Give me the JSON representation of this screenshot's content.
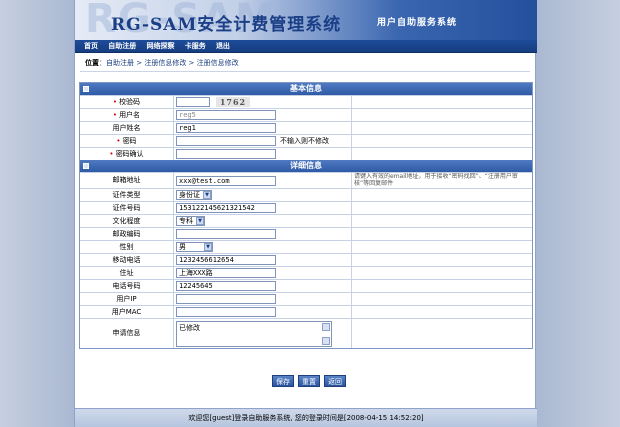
{
  "banner": {
    "ghost": "RG-SAM",
    "title": "RG-SAM安全计费管理系统",
    "subtitle": "用户自助服务系统"
  },
  "nav": {
    "items": [
      "首页",
      "自助注册",
      "网络探察",
      "卡服务",
      "退出"
    ]
  },
  "breadcrumb": {
    "label": "位置",
    "path": "自助注册 > 注册信息修改 > 注册信息修改"
  },
  "basic": {
    "title": "基本信息",
    "captcha": {
      "label": "校验码",
      "value": "",
      "code": "1762"
    },
    "username": {
      "label": "用户名",
      "value": "reg5"
    },
    "fullname": {
      "label": "用户姓名",
      "value": "reg1"
    },
    "password": {
      "label": "密码",
      "value": "",
      "hint": "不输入则不修改"
    },
    "confirm": {
      "label": "密码确认",
      "value": ""
    }
  },
  "detail": {
    "title": "详细信息",
    "email": {
      "label": "邮箱地址",
      "value": "xxx@test.com",
      "note": "请键入有效的email地址，用于接收“密码找回”、“注册用户审核”等回复邮件"
    },
    "id_type": {
      "label": "证件类型",
      "value": "身份证"
    },
    "id_number": {
      "label": "证件号码",
      "value": "153122145621321542"
    },
    "education": {
      "label": "文化程度",
      "value": "专科"
    },
    "postcode": {
      "label": "邮政编码",
      "value": ""
    },
    "gender": {
      "label": "性别",
      "value": "男"
    },
    "mobile": {
      "label": "移动电话",
      "value": "1232456612654"
    },
    "address": {
      "label": "住址",
      "value": "上海XXX路"
    },
    "phone": {
      "label": "电话号码",
      "value": "12245645"
    },
    "user_ip": {
      "label": "用户IP",
      "value": ""
    },
    "user_mac": {
      "label": "用户MAC",
      "value": ""
    },
    "apply": {
      "label": "申请信息",
      "value": "已修改"
    }
  },
  "buttons": {
    "save": "保存",
    "reset": "重置",
    "back": "返回"
  },
  "footer": {
    "text": "欢迎您[guest]登录自助服务系统, 您的登录时间是[2008-04-15 14:52:20]"
  }
}
